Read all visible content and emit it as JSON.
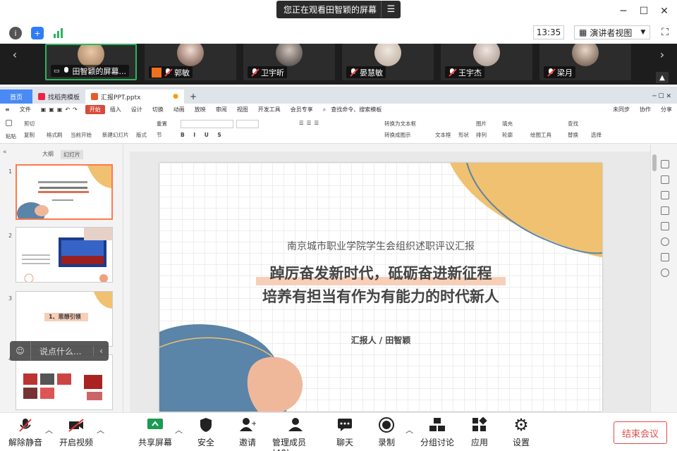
{
  "banner": {
    "text": "您正在观看田智颖的屏幕"
  },
  "top": {
    "time": "13:35",
    "view_mode": "演讲者视图"
  },
  "participants": [
    {
      "name": "田智颖的屏幕...",
      "active": true
    },
    {
      "name": "郭敏"
    },
    {
      "name": "卫宇昕"
    },
    {
      "name": "晏慧敏"
    },
    {
      "name": "王宇杰"
    },
    {
      "name": "梁月"
    }
  ],
  "wps": {
    "tabs": [
      "首页",
      "找稻壳模板",
      "汇报PPT.pptx"
    ],
    "menu": [
      "文件",
      "开始",
      "插入",
      "设计",
      "切换",
      "动画",
      "放映",
      "审阅",
      "视图",
      "开发工具",
      "会员专享"
    ],
    "menu_active": "开始",
    "search_hint": "查找命令、搜索模板",
    "right_menu": [
      "未同步",
      "协作",
      "分享"
    ],
    "ribbon": {
      "paste": "粘贴",
      "cut": "剪切",
      "copy": "复制",
      "format_painter": "格式刷",
      "start_from_current": "当前开始",
      "new_slide": "新建幻灯片",
      "layout": "版式",
      "section": "节",
      "reset": "重置",
      "text_box": "文本框",
      "shape": "形状",
      "arrange": "排列",
      "picture": "图片",
      "fill": "填充",
      "find": "查找",
      "replace": "替换",
      "select": "选择",
      "to_art": "转换成图示",
      "outline": "轮廓",
      "textbox_to": "转换为文本框",
      "drawing_tools": "绘图工具"
    },
    "sidebar_tabs": [
      "大纲",
      "幻灯片"
    ],
    "thumb3_title": "1、思想引领",
    "chat_placeholder": "说点什么...",
    "slide": {
      "subtitle": "南京城市职业学院学生会组织述职评议汇报",
      "title1": "踔厉奋发新时代，砥砺奋进新征程",
      "title2": "培养有担当有作为有能力的时代新人",
      "reporter": "汇报人 / 田智颖"
    }
  },
  "toolbar": [
    {
      "label": "解除静音"
    },
    {
      "label": "开启视频"
    },
    {
      "label": "共享屏幕"
    },
    {
      "label": "安全"
    },
    {
      "label": "邀请"
    },
    {
      "label": "管理成员(48)"
    },
    {
      "label": "聊天"
    },
    {
      "label": "录制"
    },
    {
      "label": "分组讨论"
    },
    {
      "label": "应用"
    },
    {
      "label": "设置"
    }
  ],
  "end_button": "结束会议",
  "colors": {
    "accent_orange": "#f0c170",
    "blue": "#5a84a8",
    "peach": "#f0b89b",
    "end_red": "#e14c4c"
  }
}
